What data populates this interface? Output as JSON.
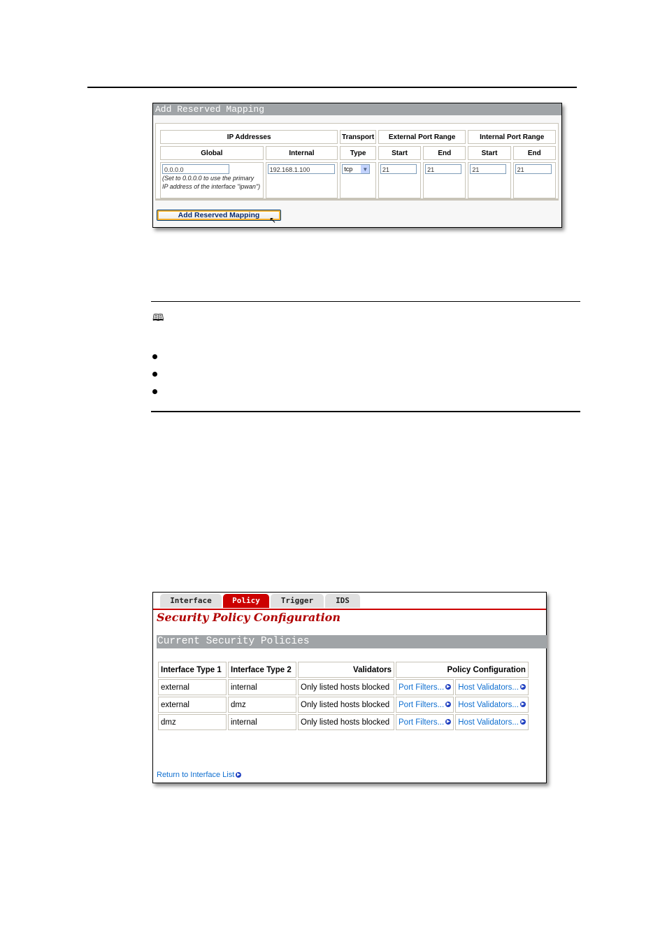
{
  "mapping_screenshot": {
    "title": "Add Reserved Mapping",
    "headers": {
      "ip_addresses": "IP Addresses",
      "transport": "Transport",
      "external_port_range": "External Port Range",
      "internal_port_range": "Internal Port Range",
      "global": "Global",
      "internal": "Internal",
      "type": "Type",
      "start": "Start",
      "end": "End"
    },
    "values": {
      "global": "0.0.0.0",
      "global_note": "(Set to 0.0.0.0 to use the primary IP address of the interface \"ipwan\")",
      "internal": "192.168.1.100",
      "transport_type": "tcp",
      "ext_start": "21",
      "ext_end": "21",
      "int_start": "21",
      "int_end": "21"
    },
    "button_label": "Add Reserved Mapping"
  },
  "policy_screenshot": {
    "tabs": [
      {
        "label": "Interface",
        "active": false
      },
      {
        "label": "Policy",
        "active": true
      },
      {
        "label": "Trigger",
        "active": false
      },
      {
        "label": "IDS",
        "active": false
      }
    ],
    "page_title": "Security Policy Configuration",
    "section_title": "Current Security Policies",
    "columns": [
      "Interface Type 1",
      "Interface Type 2",
      "Validators",
      "Policy Configuration"
    ],
    "rows": [
      {
        "type1": "external",
        "type2": "internal",
        "validators": "Only listed hosts blocked",
        "port_filters": "Port Filters...",
        "host_validators": "Host Validators..."
      },
      {
        "type1": "external",
        "type2": "dmz",
        "validators": "Only listed hosts blocked",
        "port_filters": "Port Filters...",
        "host_validators": "Host Validators..."
      },
      {
        "type1": "dmz",
        "type2": "internal",
        "validators": "Only listed hosts blocked",
        "port_filters": "Port Filters...",
        "host_validators": "Host Validators..."
      }
    ],
    "return_link": "Return to Interface List"
  },
  "note_icon": "book-icon",
  "accent_colors": {
    "tab_active": "#cc0000",
    "title_red": "#b00000",
    "link_blue": "#0f6fd0",
    "section_bar": "#a0a4a7"
  }
}
